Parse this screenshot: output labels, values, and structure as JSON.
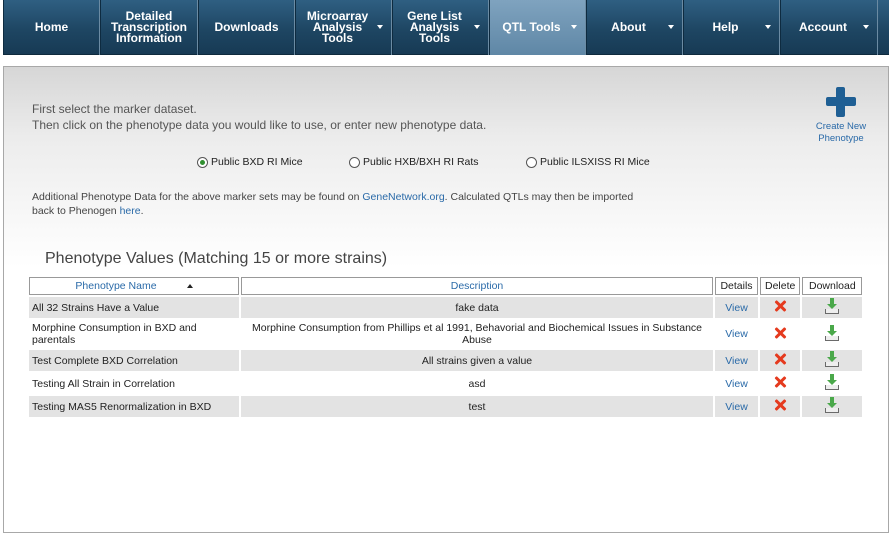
{
  "nav": [
    {
      "label": "Home",
      "dropdown": false,
      "active": false
    },
    {
      "label": "Detailed\nTranscription\nInformation",
      "dropdown": false,
      "active": false
    },
    {
      "label": "Downloads",
      "dropdown": false,
      "active": false
    },
    {
      "label": "Microarray\nAnalysis\nTools",
      "dropdown": true,
      "active": false
    },
    {
      "label": "Gene List\nAnalysis\nTools",
      "dropdown": true,
      "active": false
    },
    {
      "label": "QTL Tools",
      "dropdown": true,
      "active": true
    },
    {
      "label": "About",
      "dropdown": true,
      "active": false
    },
    {
      "label": "Help",
      "dropdown": true,
      "active": false
    },
    {
      "label": "Account",
      "dropdown": true,
      "active": false
    }
  ],
  "instructions": {
    "line1": "First select the marker dataset.",
    "line2": "Then click on the phenotype data you would like to use, or enter new phenotype data."
  },
  "create_new": {
    "label": "Create New\nPhenotype",
    "icon": "plus-icon"
  },
  "datasets": {
    "options": [
      {
        "label": "Public BXD RI Mice",
        "checked": true
      },
      {
        "label": "Public HXB/BXH RI Rats",
        "checked": false
      },
      {
        "label": "Public ILSXISS RI Mice",
        "checked": false
      }
    ]
  },
  "note": {
    "prefix": "Additional Phenotype Data for the above marker sets may be found on ",
    "link1": "GeneNetwork.org",
    "middle": ". Calculated QTLs may then be imported",
    "line2_prefix": "back to Phenogen ",
    "link2": "here",
    "suffix": "."
  },
  "section_title": "Phenotype Values (Matching 15 or more strains)",
  "table": {
    "headers": {
      "name": "Phenotype Name",
      "description": "Description",
      "details": "Details",
      "delete": "Delete",
      "download": "Download"
    },
    "view_label": "View",
    "rows": [
      {
        "name": "All 32 Strains Have a Value",
        "description": "fake data"
      },
      {
        "name": "Morphine Consumption in BXD and parentals",
        "description": "Morphine Consumption from Phillips et al 1991, Behavorial and Biochemical Issues in Substance Abuse"
      },
      {
        "name": "Test Complete BXD Correlation",
        "description": "All strains given a value"
      },
      {
        "name": "Testing All Strain in Correlation",
        "description": "asd"
      },
      {
        "name": "Testing MAS5 Renormalization in BXD",
        "description": "test"
      }
    ]
  },
  "colors": {
    "nav_bg": "#1e4663",
    "nav_active": "#6f95b3",
    "link": "#2a6aa8",
    "delete": "#e53a1e",
    "download": "#4aa84a"
  }
}
